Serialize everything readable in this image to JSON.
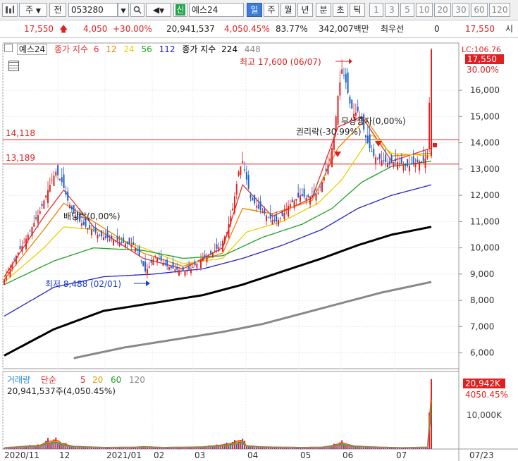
{
  "toolbar": {
    "market_label": "주",
    "period_label": "전",
    "code_value": "053280",
    "new_label": "신",
    "name_value": "예스24",
    "timeframes": [
      "일",
      "주",
      "월",
      "년",
      "분",
      "초",
      "틱"
    ],
    "numbers": [
      "1",
      "3",
      "5",
      "10",
      "20",
      "30",
      "60",
      "120"
    ],
    "colors": {
      "accent": "#3b7ddd",
      "new_badge": "#22a54a"
    }
  },
  "quote": {
    "price": "17,550",
    "change_arrow": "up-arrow-icon",
    "change": "4,050",
    "change_pct": "+30.00%",
    "volume": "20,941,537",
    "volume_pct": "4,050.45%",
    "turnover_pct": "83.77%",
    "amount": "342,007백만",
    "best_label": "최우선",
    "best_value": "0",
    "open_price": "17,550",
    "open_label": "시"
  },
  "legend": {
    "name": "예스24",
    "ma_label": "종가 지수",
    "ma_periods": [
      "6",
      "12",
      "24",
      "56",
      "112"
    ],
    "ma2_label": "종가 지수",
    "ma2_periods": [
      "224",
      "448"
    ],
    "colors": [
      "#e03030",
      "#f08000",
      "#e8d000",
      "#20a020",
      "#2020d0",
      "#000000",
      "#888888"
    ]
  },
  "price_axis": {
    "lc_label": "LC:106.76",
    "current_price": "17,550",
    "current_pct": "30.00%"
  },
  "volume_legend": {
    "label": "거래량",
    "ma_label": "단순",
    "periods": [
      "5",
      "20",
      "60",
      "120"
    ],
    "info": "20,941,537주(4,050.45%)",
    "current_value": "20,942K",
    "current_pct": "4050.45%",
    "axis_tick": "10,000K"
  },
  "chart_data": {
    "type": "candlestick",
    "title": "예스24",
    "y_ticks": [
      6000,
      7000,
      8000,
      9000,
      10000,
      11000,
      12000,
      13000,
      14000,
      15000,
      16000
    ],
    "y_tick_labels": [
      "6,000",
      "7,000",
      "8,000",
      "9,000",
      "10,000",
      "11,000",
      "12,000",
      "13,000",
      "14,000",
      "15,000",
      "16,000"
    ],
    "ylim": [
      5400,
      17800
    ],
    "x_labels": [
      "2020/11",
      "12",
      "2021/01",
      "02",
      "03",
      "04",
      "05",
      "06",
      "07",
      "07/23"
    ],
    "hlines": [
      {
        "label": "14,118",
        "value": 14118
      },
      {
        "label": "13,189",
        "value": 13189
      }
    ],
    "annotations": {
      "high": "최고 17,600 (06/07)",
      "low": "최저 8,488 (02/01)",
      "ex_dividend": "배당락(0,00%)",
      "ex_rights": "권리락(-30.99%)",
      "bonus_issue": "무상증자(0,00%)"
    },
    "price_trace": [
      [
        0,
        8800
      ],
      [
        3,
        9200
      ],
      [
        6,
        9700
      ],
      [
        10,
        10200
      ],
      [
        14,
        10800
      ],
      [
        18,
        11400
      ],
      [
        21,
        12000
      ],
      [
        24,
        12600
      ],
      [
        26,
        12900
      ],
      [
        29,
        12500
      ],
      [
        32,
        11800
      ],
      [
        35,
        11300
      ],
      [
        38,
        11000
      ],
      [
        41,
        10800
      ],
      [
        44,
        10700
      ],
      [
        47,
        10500
      ],
      [
        50,
        10400
      ],
      [
        53,
        10350
      ],
      [
        56,
        10300
      ],
      [
        59,
        10200
      ],
      [
        62,
        10150
      ],
      [
        65,
        10100
      ],
      [
        67,
        9900
      ],
      [
        69,
        9500
      ],
      [
        71,
        9100
      ],
      [
        73,
        9300
      ],
      [
        76,
        9700
      ],
      [
        79,
        9500
      ],
      [
        82,
        9300
      ],
      [
        85,
        9200
      ],
      [
        88,
        9150
      ],
      [
        91,
        9100
      ],
      [
        94,
        9200
      ],
      [
        97,
        9400
      ],
      [
        100,
        9600
      ],
      [
        103,
        9700
      ],
      [
        106,
        9900
      ],
      [
        109,
        10100
      ],
      [
        112,
        10600
      ],
      [
        115,
        11500
      ],
      [
        118,
        12900
      ],
      [
        120,
        13300
      ],
      [
        122,
        12600
      ],
      [
        124,
        11900
      ],
      [
        126,
        11700
      ],
      [
        128,
        11500
      ],
      [
        131,
        11300
      ],
      [
        134,
        11100
      ],
      [
        137,
        11000
      ],
      [
        140,
        11200
      ],
      [
        143,
        11600
      ],
      [
        146,
        11800
      ],
      [
        149,
        12000
      ],
      [
        152,
        11900
      ],
      [
        155,
        12000
      ],
      [
        158,
        12100
      ],
      [
        161,
        12700
      ],
      [
        164,
        13400
      ],
      [
        166,
        14200
      ],
      [
        168,
        15800
      ],
      [
        170,
        16800
      ],
      [
        172,
        16300
      ],
      [
        174,
        15500
      ],
      [
        176,
        15100
      ],
      [
        178,
        15200
      ],
      [
        180,
        14800
      ],
      [
        182,
        14200
      ],
      [
        184,
        13800
      ],
      [
        186,
        13500
      ],
      [
        188,
        13400
      ],
      [
        191,
        13300
      ],
      [
        194,
        13200
      ],
      [
        197,
        13300
      ],
      [
        200,
        13200
      ],
      [
        203,
        13100
      ],
      [
        206,
        13200
      ],
      [
        209,
        13300
      ],
      [
        211,
        13300
      ],
      [
        213,
        13500
      ],
      [
        215,
        17550
      ]
    ],
    "ma_series": [
      {
        "name": "6",
        "color": "#e03030",
        "values": [
          [
            0,
            8900
          ],
          [
            20,
            11200
          ],
          [
            30,
            12200
          ],
          [
            45,
            10800
          ],
          [
            70,
            9600
          ],
          [
            90,
            9200
          ],
          [
            110,
            10000
          ],
          [
            120,
            12400
          ],
          [
            135,
            11200
          ],
          [
            155,
            11900
          ],
          [
            168,
            14600
          ],
          [
            180,
            15000
          ],
          [
            195,
            13300
          ],
          [
            215,
            13800
          ]
        ]
      },
      {
        "name": "12",
        "color": "#f08000",
        "values": [
          [
            0,
            8800
          ],
          [
            20,
            10700
          ],
          [
            30,
            11700
          ],
          [
            45,
            11000
          ],
          [
            70,
            9800
          ],
          [
            90,
            9300
          ],
          [
            110,
            9800
          ],
          [
            120,
            11500
          ],
          [
            135,
            11300
          ],
          [
            155,
            11800
          ],
          [
            168,
            13800
          ],
          [
            182,
            14900
          ],
          [
            195,
            13500
          ],
          [
            215,
            13600
          ]
        ]
      },
      {
        "name": "24",
        "color": "#e8d000",
        "values": [
          [
            0,
            8700
          ],
          [
            20,
            10000
          ],
          [
            30,
            10800
          ],
          [
            45,
            10700
          ],
          [
            70,
            10000
          ],
          [
            90,
            9400
          ],
          [
            110,
            9600
          ],
          [
            122,
            10600
          ],
          [
            140,
            11000
          ],
          [
            158,
            11700
          ],
          [
            170,
            12600
          ],
          [
            185,
            14300
          ],
          [
            195,
            13600
          ],
          [
            215,
            13500
          ]
        ]
      },
      {
        "name": "56",
        "color": "#20a020",
        "values": [
          [
            0,
            8600
          ],
          [
            25,
            9500
          ],
          [
            45,
            10000
          ],
          [
            70,
            9900
          ],
          [
            90,
            9600
          ],
          [
            110,
            9700
          ],
          [
            130,
            10400
          ],
          [
            150,
            10900
          ],
          [
            165,
            11500
          ],
          [
            180,
            12500
          ],
          [
            195,
            13100
          ],
          [
            215,
            13300
          ]
        ]
      },
      {
        "name": "112",
        "color": "#2020d0",
        "values": [
          [
            0,
            7400
          ],
          [
            25,
            8500
          ],
          [
            50,
            8900
          ],
          [
            75,
            9000
          ],
          [
            100,
            9200
          ],
          [
            120,
            9600
          ],
          [
            140,
            10100
          ],
          [
            160,
            10700
          ],
          [
            178,
            11500
          ],
          [
            195,
            12000
          ],
          [
            215,
            12400
          ]
        ]
      },
      {
        "name": "224",
        "color": "#000000",
        "values": [
          [
            0,
            5900
          ],
          [
            25,
            6900
          ],
          [
            50,
            7600
          ],
          [
            75,
            7900
          ],
          [
            100,
            8200
          ],
          [
            120,
            8600
          ],
          [
            140,
            9100
          ],
          [
            160,
            9600
          ],
          [
            178,
            10100
          ],
          [
            195,
            10500
          ],
          [
            215,
            10800
          ]
        ]
      },
      {
        "name": "448",
        "color": "#888888",
        "values": [
          [
            35,
            5800
          ],
          [
            60,
            6200
          ],
          [
            85,
            6500
          ],
          [
            110,
            6800
          ],
          [
            130,
            7100
          ],
          [
            150,
            7500
          ],
          [
            170,
            7900
          ],
          [
            190,
            8300
          ],
          [
            215,
            8700
          ]
        ]
      }
    ],
    "volume_trace": [
      [
        0,
        0.3
      ],
      [
        10,
        0.8
      ],
      [
        18,
        1.2
      ],
      [
        22,
        2.6
      ],
      [
        27,
        3.0
      ],
      [
        29,
        1.8
      ],
      [
        35,
        0.8
      ],
      [
        50,
        0.4
      ],
      [
        66,
        0.5
      ],
      [
        70,
        0.7
      ],
      [
        80,
        0.4
      ],
      [
        100,
        0.6
      ],
      [
        112,
        1.5
      ],
      [
        116,
        2.3
      ],
      [
        118,
        3.0
      ],
      [
        120,
        2.8
      ],
      [
        122,
        1.0
      ],
      [
        130,
        0.6
      ],
      [
        150,
        0.4
      ],
      [
        160,
        0.5
      ],
      [
        165,
        1.0
      ],
      [
        168,
        1.7
      ],
      [
        170,
        2.2
      ],
      [
        175,
        1.0
      ],
      [
        185,
        0.6
      ],
      [
        200,
        0.3
      ],
      [
        213,
        0.5
      ],
      [
        215,
        20.9
      ]
    ]
  }
}
